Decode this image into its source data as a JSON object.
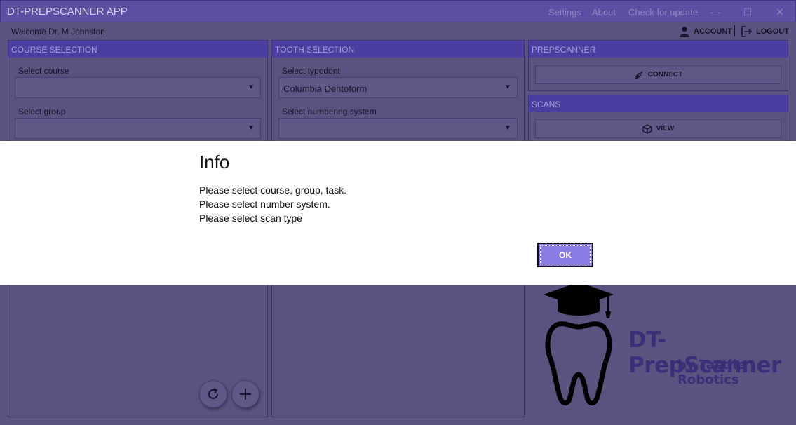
{
  "window": {
    "title": "DT-PREPSCANNER APP",
    "links": [
      "Settings",
      "About",
      "Check for update"
    ],
    "controls": {
      "minimize": "—",
      "maximize": "☐",
      "close": "✕"
    }
  },
  "header": {
    "welcome": "Welcome Dr. M Johnston",
    "account_label": "ACCOUNT",
    "logout_label": "LOGOUT"
  },
  "course_panel": {
    "title": "COURSE SELECTION",
    "course_label": "Select course",
    "course_value": "",
    "group_label": "Select group",
    "group_value": ""
  },
  "tooth_panel": {
    "title": "TOOTH SELECTION",
    "typodont_label": "Select typodont",
    "typodont_value": "Columbia Dentoform",
    "numbering_label": "Select numbering system",
    "numbering_value": ""
  },
  "prepscanner_panel": {
    "title": "PREPSCANNER",
    "connect_label": "CONNECT"
  },
  "scans_panel": {
    "title": "SCANS",
    "view_label": "VIEW"
  },
  "logo": {
    "name": "DT-PrepScanner",
    "byline": "by Tactile Robotics"
  },
  "dialog": {
    "title": "Info",
    "messages": [
      "Please select course, group, task.",
      "Please select number system.",
      "Please select scan type"
    ],
    "ok_label": "OK"
  },
  "colors": {
    "accent": "#8a7ee6",
    "title_bar": "#5b4fa3",
    "panel_header": "#4a3fa0"
  }
}
